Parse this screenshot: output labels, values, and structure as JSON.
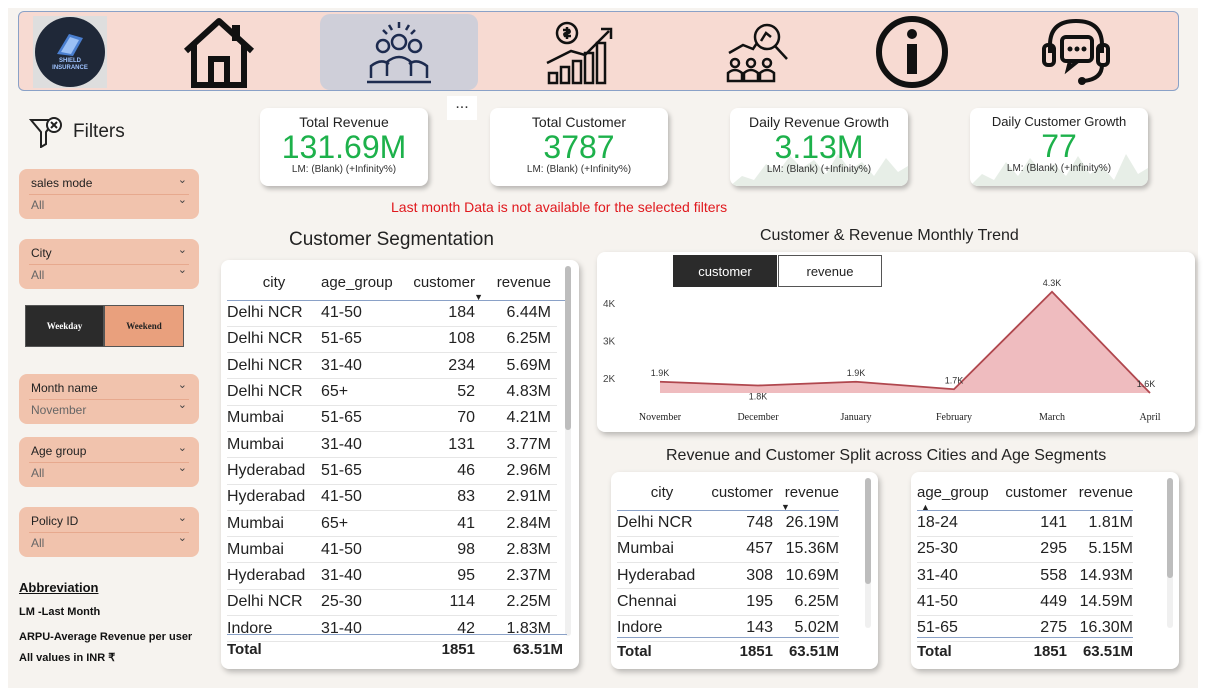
{
  "nav": {
    "logo_line1": "SHIELD",
    "logo_line2": "INSURANCE",
    "items": [
      "home",
      "customers",
      "revenue-growth",
      "analysis",
      "info",
      "support"
    ]
  },
  "filters": {
    "title": "Filters",
    "slicers": [
      {
        "label": "sales mode",
        "value": "All"
      },
      {
        "label": "City",
        "value": "All"
      },
      {
        "label": "Month name",
        "value": "November"
      },
      {
        "label": "Age group",
        "value": "All"
      },
      {
        "label": "Policy ID",
        "value": "All"
      }
    ],
    "weekday": "Weekday",
    "weekend": "Weekend"
  },
  "abbreviation": {
    "title": "Abbreviation",
    "lines": [
      "LM -Last Month",
      "ARPU-Average Revenue per user",
      "All values in INR ₹"
    ]
  },
  "kpis": [
    {
      "title": "Total Revenue",
      "value": "131.69M",
      "sub": "LM: (Blank) (+Infinity%)"
    },
    {
      "title": "Total Customer",
      "value": "3787",
      "sub": "LM: (Blank) (+Infinity%)"
    },
    {
      "title": "Daily Revenue Growth",
      "value": "3.13M",
      "sub": "LM: (Blank) (+Infinity%)"
    },
    {
      "title": "Daily Customer Growth",
      "value": "77",
      "sub": "LM: (Blank) (+Infinity%)"
    }
  ],
  "more_icon": "...",
  "warning": "Last month Data is not available for the selected filters",
  "segmentation": {
    "title": "Customer Segmentation",
    "columns": [
      "city",
      "age_group",
      "customer",
      "revenue"
    ],
    "rows": [
      [
        "Delhi NCR",
        "41-50",
        "184",
        "6.44M"
      ],
      [
        "Delhi NCR",
        "51-65",
        "108",
        "6.25M"
      ],
      [
        "Delhi NCR",
        "31-40",
        "234",
        "5.69M"
      ],
      [
        "Delhi NCR",
        "65+",
        "52",
        "4.83M"
      ],
      [
        "Mumbai",
        "51-65",
        "70",
        "4.21M"
      ],
      [
        "Mumbai",
        "31-40",
        "131",
        "3.77M"
      ],
      [
        "Hyderabad",
        "51-65",
        "46",
        "2.96M"
      ],
      [
        "Hyderabad",
        "41-50",
        "83",
        "2.91M"
      ],
      [
        "Mumbai",
        "65+",
        "41",
        "2.84M"
      ],
      [
        "Mumbai",
        "41-50",
        "98",
        "2.83M"
      ],
      [
        "Hyderabad",
        "31-40",
        "95",
        "2.37M"
      ],
      [
        "Delhi NCR",
        "25-30",
        "114",
        "2.25M"
      ],
      [
        "Indore",
        "31-40",
        "42",
        "1.83M"
      ]
    ],
    "total": [
      "Total",
      "",
      "1851",
      "63.51M"
    ]
  },
  "trend": {
    "title": "Customer & Revenue Monthly Trend",
    "toggle_customer": "customer",
    "toggle_revenue": "revenue"
  },
  "chart_data": {
    "type": "area",
    "x": [
      "November",
      "December",
      "January",
      "February",
      "March",
      "April"
    ],
    "series": [
      {
        "values": [
          1900,
          1800,
          1900,
          1700,
          4300,
          1600
        ]
      }
    ],
    "data_labels": [
      "1.9K",
      "1.8K",
      "1.9K",
      "1.7K",
      "4.3K",
      "1.6K"
    ],
    "yticks": [
      "2K",
      "3K",
      "4K"
    ],
    "ylim": [
      1600,
      4400
    ],
    "grid": false,
    "color": "#e9a6aa"
  },
  "split": {
    "title": "Revenue and Customer Split across Cities and Age Segments",
    "city_table": {
      "columns": [
        "city",
        "customer",
        "revenue"
      ],
      "rows": [
        [
          "Delhi NCR",
          "748",
          "26.19M"
        ],
        [
          "Mumbai",
          "457",
          "15.36M"
        ],
        [
          "Hyderabad",
          "308",
          "10.69M"
        ],
        [
          "Chennai",
          "195",
          "6.25M"
        ],
        [
          "Indore",
          "143",
          "5.02M"
        ]
      ],
      "total": [
        "Total",
        "1851",
        "63.51M"
      ]
    },
    "age_table": {
      "columns": [
        "age_group",
        "customer",
        "revenue"
      ],
      "rows": [
        [
          "18-24",
          "141",
          "1.81M"
        ],
        [
          "25-30",
          "295",
          "5.15M"
        ],
        [
          "31-40",
          "558",
          "14.93M"
        ],
        [
          "41-50",
          "449",
          "14.59M"
        ],
        [
          "51-65",
          "275",
          "16.30M"
        ]
      ],
      "total": [
        "Total",
        "1851",
        "63.51M"
      ]
    }
  },
  "colors": {
    "accent_green": "#1db14b",
    "warning_red": "#e0181d",
    "slicer_bg": "#f1c3ad",
    "nav_bg": "#f7dad2"
  }
}
